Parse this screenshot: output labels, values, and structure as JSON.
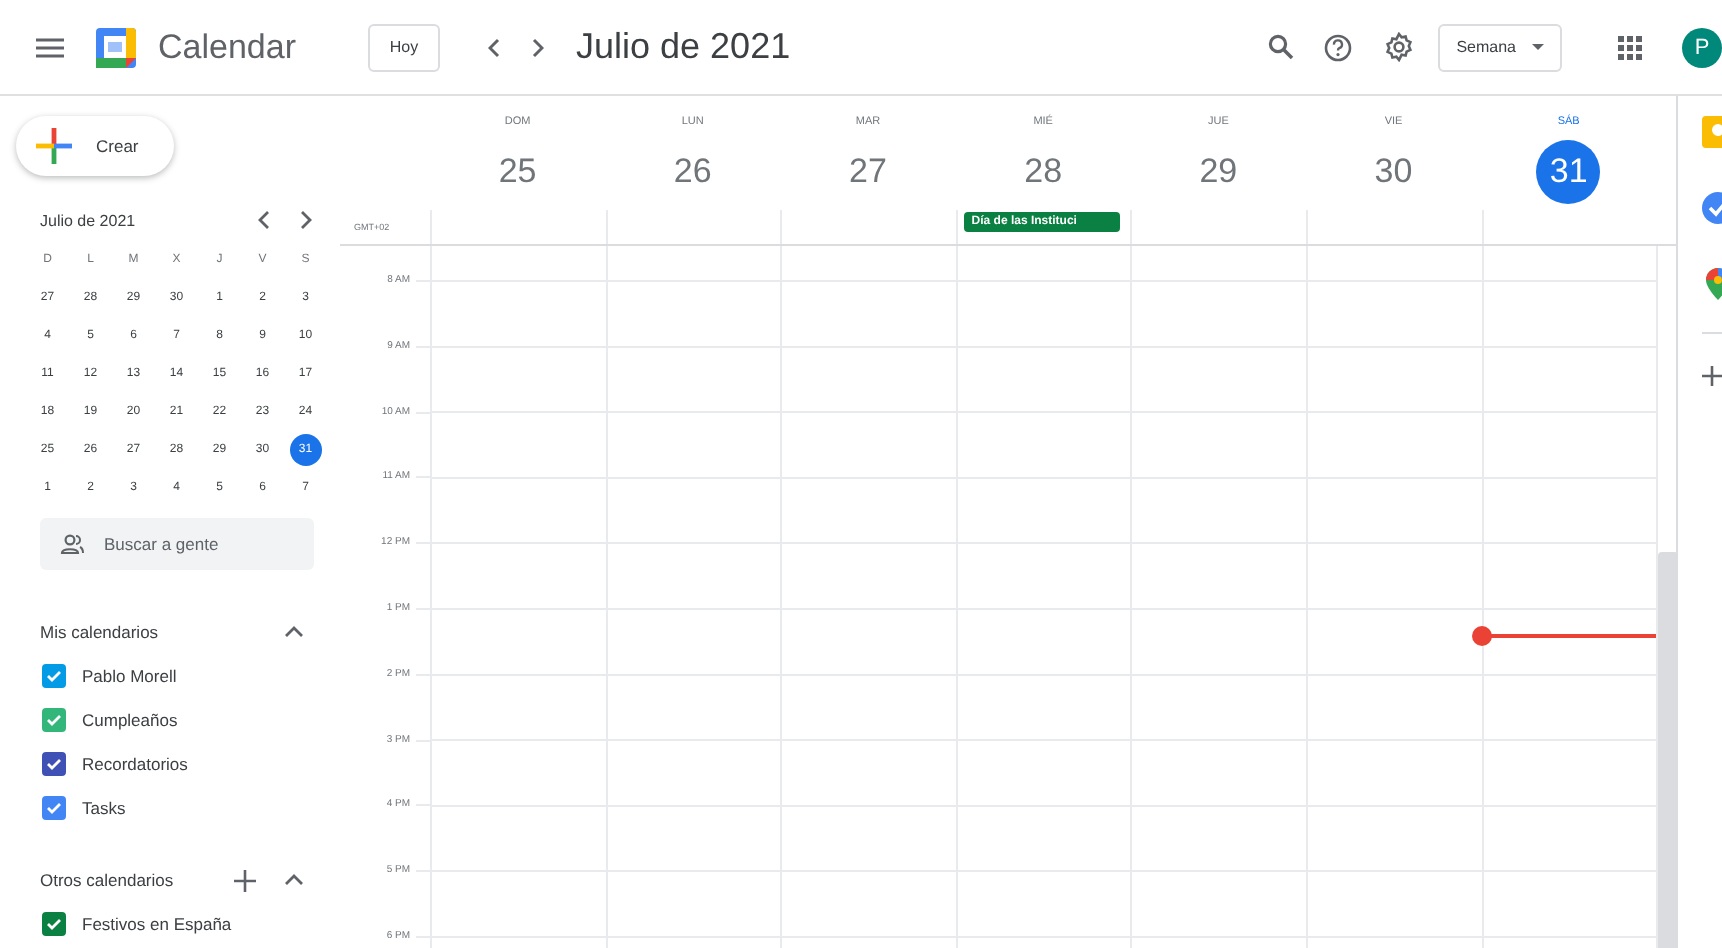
{
  "app_bar": {
    "product": "Calendar",
    "today_button": "Hoy",
    "period": "Julio de 2021",
    "view_menu": "Semana",
    "avatar": "P"
  },
  "create_button": "Crear",
  "mini_calendar": {
    "title": "Julio de 2021",
    "weekdays": [
      "D",
      "L",
      "M",
      "X",
      "J",
      "V",
      "S"
    ],
    "weeks": [
      [
        {
          "day": "27",
          "selected": false
        },
        {
          "day": "28",
          "selected": false
        },
        {
          "day": "29",
          "selected": false
        },
        {
          "day": "30",
          "selected": false
        },
        {
          "day": "1",
          "selected": false
        },
        {
          "day": "2",
          "selected": false
        },
        {
          "day": "3",
          "selected": false
        }
      ],
      [
        {
          "day": "4",
          "selected": false
        },
        {
          "day": "5",
          "selected": false
        },
        {
          "day": "6",
          "selected": false
        },
        {
          "day": "7",
          "selected": false
        },
        {
          "day": "8",
          "selected": false
        },
        {
          "day": "9",
          "selected": false
        },
        {
          "day": "10",
          "selected": false
        }
      ],
      [
        {
          "day": "11",
          "selected": false
        },
        {
          "day": "12",
          "selected": false
        },
        {
          "day": "13",
          "selected": false
        },
        {
          "day": "14",
          "selected": false
        },
        {
          "day": "15",
          "selected": false
        },
        {
          "day": "16",
          "selected": false
        },
        {
          "day": "17",
          "selected": false
        }
      ],
      [
        {
          "day": "18",
          "selected": false
        },
        {
          "day": "19",
          "selected": false
        },
        {
          "day": "20",
          "selected": false
        },
        {
          "day": "21",
          "selected": false
        },
        {
          "day": "22",
          "selected": false
        },
        {
          "day": "23",
          "selected": false
        },
        {
          "day": "24",
          "selected": false
        }
      ],
      [
        {
          "day": "25",
          "selected": false
        },
        {
          "day": "26",
          "selected": false
        },
        {
          "day": "27",
          "selected": false
        },
        {
          "day": "28",
          "selected": false
        },
        {
          "day": "29",
          "selected": false
        },
        {
          "day": "30",
          "selected": false
        },
        {
          "day": "31",
          "selected": true
        }
      ],
      [
        {
          "day": "1",
          "selected": false
        },
        {
          "day": "2",
          "selected": false
        },
        {
          "day": "3",
          "selected": false
        },
        {
          "day": "4",
          "selected": false
        },
        {
          "day": "5",
          "selected": false
        },
        {
          "day": "6",
          "selected": false
        },
        {
          "day": "7",
          "selected": false
        }
      ]
    ]
  },
  "people_search": {
    "placeholder": "Buscar a gente"
  },
  "my_calendars": {
    "title": "Mis calendarios",
    "expanded": true,
    "items": [
      {
        "name": "Pablo Morell",
        "checked": true,
        "color": "#039be5"
      },
      {
        "name": "Cumpleaños",
        "checked": true,
        "color": "#33b679"
      },
      {
        "name": "Recordatorios",
        "checked": true,
        "color": "#3f51b5"
      },
      {
        "name": "Tasks",
        "checked": true,
        "color": "#4285f4"
      }
    ]
  },
  "other_calendars": {
    "title": "Otros calendarios",
    "expanded": true,
    "items": [
      {
        "name": "Festivos en España",
        "checked": true,
        "color": "#0b8043"
      }
    ]
  },
  "week": {
    "timezone": "GMT+02",
    "days": [
      {
        "weekday": "DOM",
        "date": "25",
        "selected": false,
        "now": false
      },
      {
        "weekday": "LUN",
        "date": "26",
        "selected": false,
        "now": false
      },
      {
        "weekday": "MAR",
        "date": "27",
        "selected": false,
        "now": false
      },
      {
        "weekday": "MIÉ",
        "date": "28",
        "selected": false,
        "now": false,
        "all_day_events": [
          {
            "title": "Día de las Instituci",
            "color": "#0b8043"
          }
        ]
      },
      {
        "weekday": "JUE",
        "date": "29",
        "selected": false,
        "now": false
      },
      {
        "weekday": "VIE",
        "date": "30",
        "selected": false,
        "now": false
      },
      {
        "weekday": "SÁB",
        "date": "31",
        "selected": true,
        "now": true
      }
    ],
    "hours": [
      "8 AM",
      "9 AM",
      "10 AM",
      "11 AM",
      "12 PM",
      "1 PM",
      "2 PM",
      "3 PM",
      "4 PM",
      "5 PM",
      "6 PM"
    ]
  }
}
